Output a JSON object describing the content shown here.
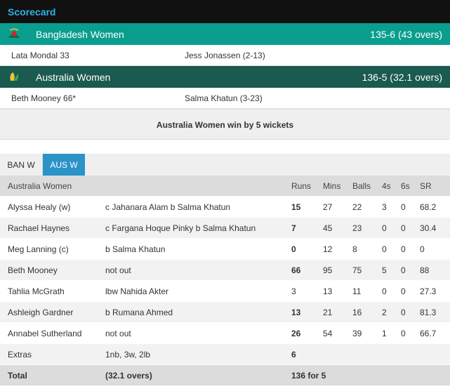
{
  "header": {
    "title": "Scorecard"
  },
  "innings": [
    {
      "team": "Bangladesh Women",
      "score": "135-6 (43 overs)",
      "top_bat": "Lata Mondal 33",
      "top_bowl": "Jess Jonassen (2-13)"
    },
    {
      "team": "Australia Women",
      "score": "136-5 (32.1 overs)",
      "top_bat": "Beth Mooney 66*",
      "top_bowl": "Salma Khatun (3-23)"
    }
  ],
  "colors": {
    "ban_row": "#0a9e8f",
    "aus_row": "#1b5a4f",
    "accent_tab": "#2a93c8",
    "title": "#2db3e3"
  },
  "result": "Australia Women win by 5 wickets",
  "tabs": [
    {
      "label": "BAN W",
      "active": false
    },
    {
      "label": "AUS W",
      "active": true
    }
  ],
  "table": {
    "headers": {
      "team": "Australia Women",
      "runs": "Runs",
      "mins": "Mins",
      "balls": "Balls",
      "fours": "4s",
      "sixes": "6s",
      "sr": "SR"
    },
    "rows": [
      {
        "name": "Alyssa Healy (w)",
        "dismissal": "c Jahanara Alam b Salma Khatun",
        "runs": "15",
        "mins": "27",
        "balls": "22",
        "fours": "3",
        "sixes": "0",
        "sr": "68.2"
      },
      {
        "name": "Rachael Haynes",
        "dismissal": "c Fargana Hoque Pinky b Salma Khatun",
        "runs": "7",
        "mins": "45",
        "balls": "23",
        "fours": "0",
        "sixes": "0",
        "sr": "30.4"
      },
      {
        "name": "Meg Lanning (c)",
        "dismissal": "b Salma Khatun",
        "runs": "0",
        "mins": "12",
        "balls": "8",
        "fours": "0",
        "sixes": "0",
        "sr": "0"
      },
      {
        "name": "Beth Mooney",
        "dismissal": "not out",
        "runs": "66",
        "mins": "95",
        "balls": "75",
        "fours": "5",
        "sixes": "0",
        "sr": "88"
      },
      {
        "name": "Tahlia McGrath",
        "dismissal": "lbw Nahida Akter",
        "runs": "3",
        "mins": "13",
        "balls": "11",
        "fours": "0",
        "sixes": "0",
        "sr": "27.3"
      },
      {
        "name": "Ashleigh Gardner",
        "dismissal": "b Rumana Ahmed",
        "runs": "13",
        "mins": "21",
        "balls": "16",
        "fours": "2",
        "sixes": "0",
        "sr": "81.3"
      },
      {
        "name": "Annabel Sutherland",
        "dismissal": "not out",
        "runs": "26",
        "mins": "54",
        "balls": "39",
        "fours": "1",
        "sixes": "0",
        "sr": "66.7"
      }
    ],
    "extras": {
      "label": "Extras",
      "detail": "1nb, 3w, 2lb",
      "runs": "6"
    },
    "total": {
      "label": "Total",
      "detail": "(32.1 overs)",
      "runs": "136 for 5"
    }
  }
}
